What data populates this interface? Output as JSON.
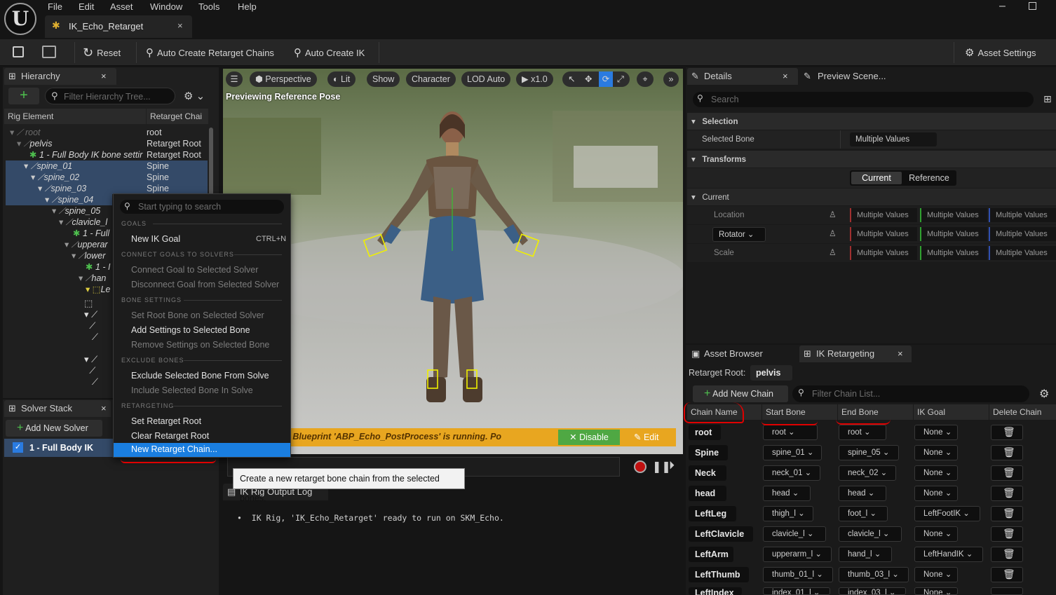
{
  "menu": {
    "file": "File",
    "edit": "Edit",
    "asset": "Asset",
    "window": "Window",
    "tools": "Tools",
    "help": "Help"
  },
  "doc_tab": "IK_Echo_Retarget",
  "toolbar": {
    "reset": "Reset",
    "auto_chains": "Auto Create Retarget Chains",
    "auto_ik": "Auto Create IK",
    "asset_settings": "Asset Settings"
  },
  "hierarchy": {
    "tab": "Hierarchy",
    "filter_placeholder": "Filter Hierarchy Tree...",
    "col_rig": "Rig Element",
    "col_chain": "Retarget Chai",
    "rows": [
      {
        "name": "root",
        "chain": "root"
      },
      {
        "name": "pelvis",
        "chain": "Retarget Root"
      },
      {
        "name": "1 - Full Body IK bone settir",
        "chain": "Retarget Root"
      },
      {
        "name": "spine_01",
        "chain": "Spine"
      },
      {
        "name": "spine_02",
        "chain": "Spine"
      },
      {
        "name": "spine_03",
        "chain": "Spine"
      },
      {
        "name": "spine_04",
        "chain": ""
      },
      {
        "name": "spine_05",
        "chain": ""
      },
      {
        "name": "clavicle_l",
        "chain": ""
      },
      {
        "name": "1 - Full",
        "chain": ""
      },
      {
        "name": "upperar",
        "chain": ""
      },
      {
        "name": "lower",
        "chain": ""
      },
      {
        "name": "1 - I",
        "chain": ""
      },
      {
        "name": "han",
        "chain": ""
      },
      {
        "name": "Le",
        "chain": ""
      }
    ]
  },
  "solver": {
    "tab": "Solver Stack",
    "add": "Add New Solver",
    "item": "1 - Full Body IK"
  },
  "context": {
    "search_placeholder": "Start typing to search",
    "goals": "GOALS",
    "new_goal": "New IK Goal",
    "new_goal_key": "CTRL+N",
    "connect": "CONNECT GOALS TO SOLVERS",
    "connect_goal": "Connect Goal to Selected Solver",
    "disconnect_goal": "Disconnect Goal from Selected Solver",
    "bone": "BONE SETTINGS",
    "set_root": "Set Root Bone on Selected Solver",
    "add_settings": "Add Settings to Selected Bone",
    "remove_settings": "Remove Settings on Selected Bone",
    "exclude": "EXCLUDE BONES",
    "exclude_bone": "Exclude Selected Bone From Solve",
    "include_bone": "Include Selected Bone In Solve",
    "retargeting": "RETARGETING",
    "set_retarget_root": "Set Retarget Root",
    "clear_retarget_root": "Clear Retarget Root",
    "new_chain": "New Retarget Chain..."
  },
  "tooltip": "Create a new retarget bone chain from the selected bones.",
  "viewport": {
    "perspective": "Perspective",
    "lit": "Lit",
    "show": "Show",
    "character": "Character",
    "lod": "LOD Auto",
    "speed": "x1.0",
    "status": "Previewing Reference Pose",
    "warning": "cess Animation Blueprint 'ABP_Echo_PostProcess' is running. Po",
    "disable": "Disable",
    "edit": "Edit"
  },
  "log": {
    "tab": "IK Rig Output Log",
    "line": "IK Rig, 'IK_Echo_Retarget' ready to run on SKM_Echo."
  },
  "details": {
    "tab": "Details",
    "tab2": "Preview Scene...",
    "search": "Search",
    "selection": "Selection",
    "selected_bone": "Selected Bone",
    "multiple": "Multiple Values",
    "transforms": "Transforms",
    "current_btn": "Current",
    "reference_btn": "Reference",
    "current": "Current",
    "location": "Location",
    "rotator": "Rotator",
    "scale": "Scale"
  },
  "retarget": {
    "tab_browser": "Asset Browser",
    "tab_ik": "IK Retargeting",
    "root_label": "Retarget Root:",
    "root_value": "pelvis",
    "add_chain": "Add New Chain",
    "filter": "Filter Chain List...",
    "columns": [
      "Chain Name",
      "Start Bone",
      "End Bone",
      "IK Goal",
      "Delete Chain"
    ],
    "rows": [
      {
        "name": "root",
        "start": "root",
        "end": "root",
        "goal": "None"
      },
      {
        "name": "Spine",
        "start": "spine_01",
        "end": "spine_05",
        "goal": "None"
      },
      {
        "name": "Neck",
        "start": "neck_01",
        "end": "neck_02",
        "goal": "None"
      },
      {
        "name": "head",
        "start": "head",
        "end": "head",
        "goal": "None"
      },
      {
        "name": "LeftLeg",
        "start": "thigh_l",
        "end": "foot_l",
        "goal": "LeftFootIK"
      },
      {
        "name": "LeftClavicle",
        "start": "clavicle_l",
        "end": "clavicle_l",
        "goal": "None"
      },
      {
        "name": "LeftArm",
        "start": "upperarm_l",
        "end": "hand_l",
        "goal": "LeftHandIK"
      },
      {
        "name": "LeftThumb",
        "start": "thumb_01_l",
        "end": "thumb_03_l",
        "goal": "None"
      },
      {
        "name": "LeftIndex",
        "start": "index_01_l",
        "end": "index_03_l",
        "goal": "None"
      }
    ]
  }
}
